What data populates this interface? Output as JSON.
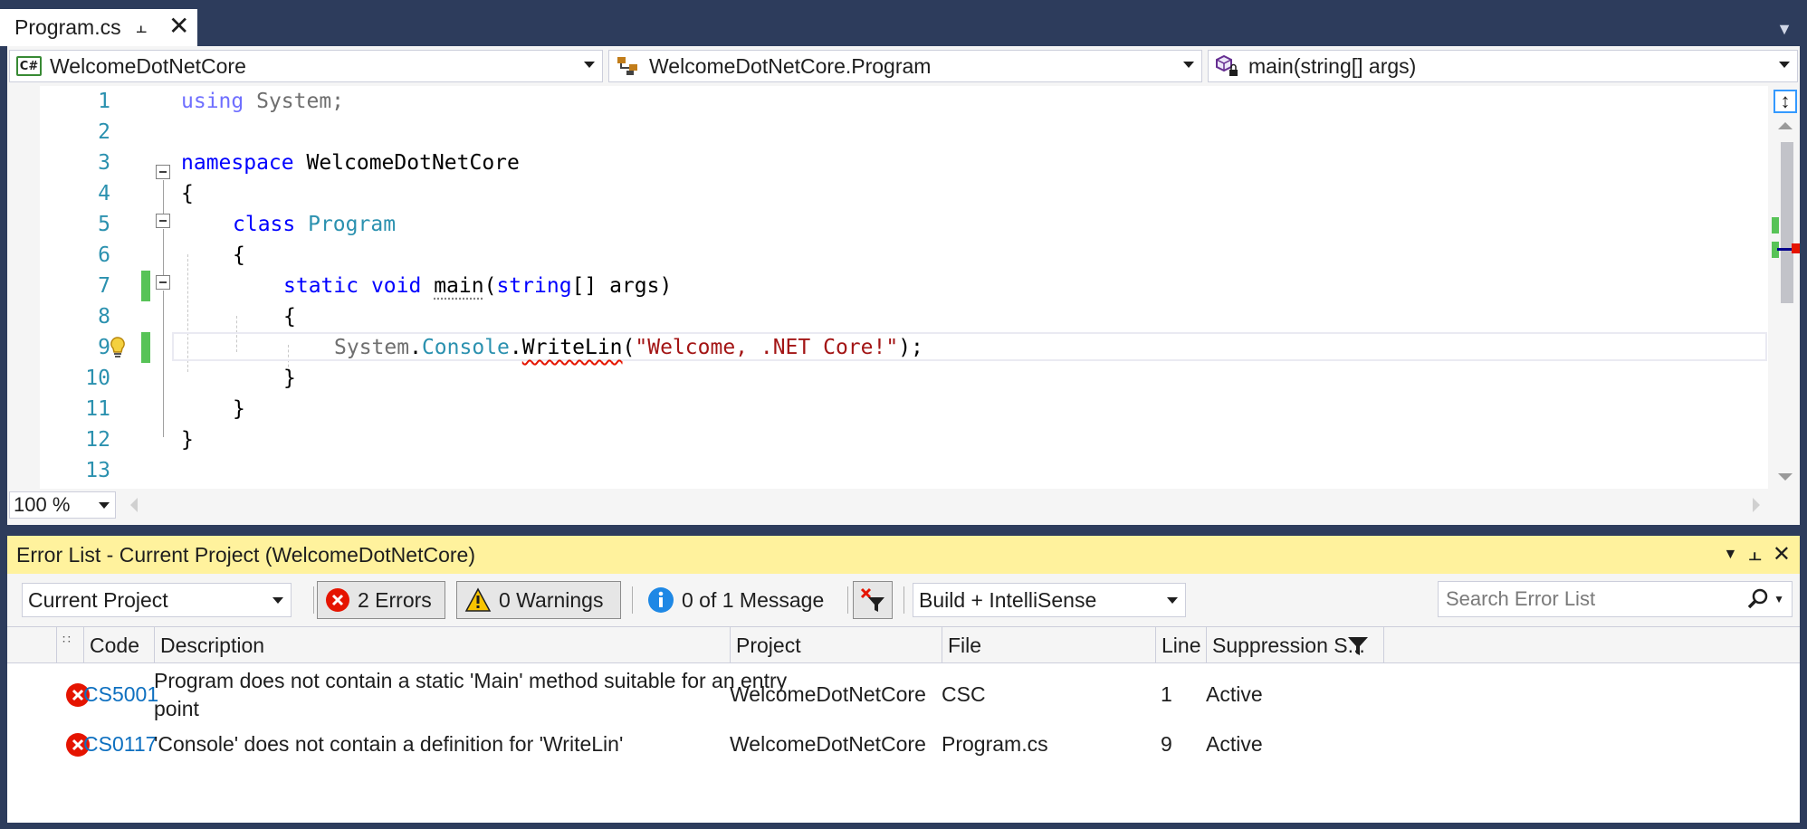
{
  "tab": {
    "title": "Program.cs"
  },
  "navbar": {
    "project": "WelcomeDotNetCore",
    "class": "WelcomeDotNetCore.Program",
    "member": "main(string[] args)"
  },
  "editor": {
    "line_numbers": [
      "1",
      "2",
      "3",
      "4",
      "5",
      "6",
      "7",
      "8",
      "9",
      "10",
      "11",
      "12",
      "13"
    ],
    "code": {
      "l1_kw": "using",
      "l1_rest": " System;",
      "l3_kw": "namespace",
      "l3_rest": " WelcomeDotNetCore",
      "l4": "{",
      "l5_kw": "class",
      "l5_type": "Program",
      "l6": "{",
      "l7_kw1": "static",
      "l7_kw2": "void",
      "l7_name": "main",
      "l7_kw3": "string",
      "l7_rest": "[] args)",
      "l8": "{",
      "l9_ns": "System",
      "l9_type": "Console",
      "l9_method": "WriteLin",
      "l9_str": "\"Welcome, .NET Core!\"",
      "l9_end": ");",
      "l10": "}",
      "l11": "}",
      "l12": "}"
    },
    "zoom": "100 %"
  },
  "error_list": {
    "title": "Error List - Current Project (WelcomeDotNetCore)",
    "scope": "Current Project",
    "errors_label": "2 Errors",
    "warnings_label": "0 Warnings",
    "messages_label": "0 of 1 Message",
    "source": "Build + IntelliSense",
    "search_placeholder": "Search Error List",
    "columns": [
      "Code",
      "Description",
      "Project",
      "File",
      "Line",
      "Suppression S..."
    ],
    "rows": [
      {
        "code": "CS5001",
        "description_line1": "Program does not contain a static 'Main' method suitable for an entry",
        "description_line2": "point",
        "project": "WelcomeDotNetCore",
        "file": "CSC",
        "line": "1",
        "suppression": "Active"
      },
      {
        "code": "CS0117",
        "description_line1": "'Console' does not contain a definition for 'WriteLin'",
        "project": "WelcomeDotNetCore",
        "file": "Program.cs",
        "line": "9",
        "suppression": "Active"
      }
    ]
  },
  "colors": {
    "chrome": "#2d3c5c",
    "keyword": "#0000ff",
    "type": "#2b91af",
    "string": "#a31515",
    "error": "#e51400",
    "change_bar": "#57c357",
    "error_list_title": "#fff29d"
  }
}
